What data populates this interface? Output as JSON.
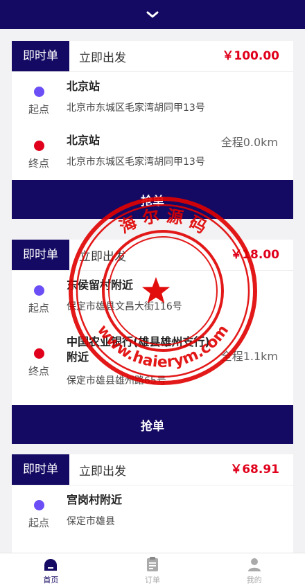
{
  "header": {
    "toggle_icon": "chevron-down-icon"
  },
  "orders": [
    {
      "type_tag": "即时单",
      "depart": "立即出发",
      "price": "￥100.00",
      "start": {
        "kind": "起点",
        "name": "北京站",
        "address": "北京市东城区毛家湾胡同甲13号"
      },
      "end": {
        "kind": "终点",
        "name": "北京站",
        "address": "北京市东城区毛家湾胡同甲13号",
        "distance": "全程0.0km"
      },
      "button": "抢单"
    },
    {
      "type_tag": "即时单",
      "depart": "立即出发",
      "price": "￥18.00",
      "start": {
        "kind": "起点",
        "name": "东侯留村附近",
        "address": "保定市雄县文昌大街116号"
      },
      "end": {
        "kind": "终点",
        "name": "中国农业银行(雄县雄州支行)附近",
        "address": "保定市雄县雄州路65号",
        "distance": "全程1.1km"
      },
      "button": "抢单"
    },
    {
      "type_tag": "即时单",
      "depart": "立即出发",
      "price": "￥68.91",
      "start": {
        "kind": "起点",
        "name": "宫岗村附近",
        "address": "保定市雄县"
      }
    }
  ],
  "tabbar": [
    {
      "label": "首页",
      "icon": "home-icon",
      "active": true
    },
    {
      "label": "订单",
      "icon": "clipboard-icon",
      "active": false
    },
    {
      "label": "我的",
      "icon": "user-icon",
      "active": false
    }
  ],
  "watermark": {
    "top_text": "海 尔 源 码",
    "bottom_text": "www.haierym.com",
    "color": "#e00000"
  }
}
